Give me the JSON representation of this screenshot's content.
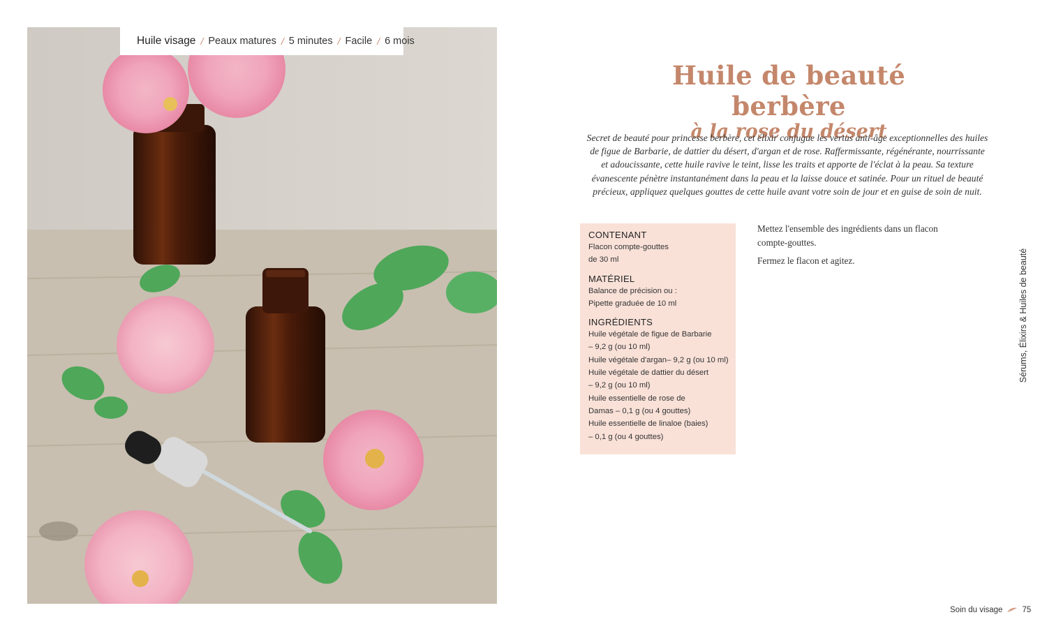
{
  "tags": {
    "category": "Huile visage",
    "skin": "Peaux matures",
    "time": "5 minutes",
    "difficulty": "Facile",
    "shelf_life": "6 mois"
  },
  "title": {
    "line1": "Huile de beauté berbère",
    "line2": "à la rose du désert"
  },
  "intro": [
    "Secret de beauté pour princesse berbère, cet élixir conjugue les vertus anti-âge exceptionnelles des huiles",
    "de figue de Barbarie, de dattier du désert, d'argan et de rose. Raffermissante, régénérante, nourrissante",
    "et adoucissante, cette huile ravive le teint, lisse les traits et apporte de l'éclat à la peau. Sa texture",
    "évanescente pénètre instantanément dans la peau et la laisse douce et satinée. Pour un rituel de beauté",
    "précieux, appliquez quelques gouttes de cette huile avant votre soin de jour et en guise de soin de nuit."
  ],
  "box": {
    "container": {
      "heading": "CONTENANT",
      "lines": [
        "Flacon compte-gouttes",
        "de 30 ml"
      ]
    },
    "material": {
      "heading": "MATÉRIEL",
      "lines": [
        "Balance de précision ou :",
        "Pipette graduée de 10 ml"
      ]
    },
    "ingredients": {
      "heading": "INGRÉDIENTS",
      "lines": [
        "Huile végétale de figue de Barbarie",
        "– 9,2 g (ou 10 ml)",
        "Huile végétale d'argan– 9,2 g (ou 10 ml)",
        "Huile végétale de dattier du désert",
        "– 9,2 g (ou 10 ml)",
        "Huile essentielle de rose de",
        "Damas – 0,1 g (ou 4 gouttes)",
        "Huile essentielle de linaloe (baies)",
        "– 0,1 g (ou 4 gouttes)"
      ]
    }
  },
  "steps": [
    "Mettez l'ensemble des ingrédients dans un flacon compte-gouttes.",
    "Fermez le flacon et agitez."
  ],
  "side_label": "Sérums, Élixirs & Huiles de beauté",
  "footer": {
    "section": "Soin du visage",
    "page": "75"
  },
  "colors": {
    "accent": "#c4876b",
    "box_background": "#f9e1d8"
  }
}
